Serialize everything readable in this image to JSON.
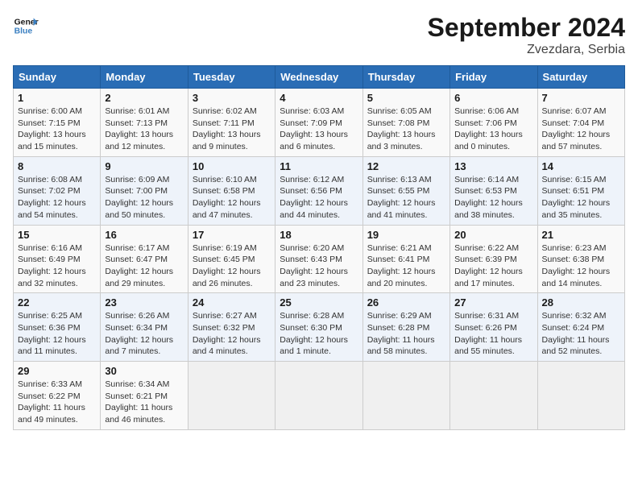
{
  "logo": {
    "line1": "General",
    "line2": "Blue"
  },
  "title": "September 2024",
  "subtitle": "Zvezdara, Serbia",
  "days_of_week": [
    "Sunday",
    "Monday",
    "Tuesday",
    "Wednesday",
    "Thursday",
    "Friday",
    "Saturday"
  ],
  "weeks": [
    [
      {
        "day": "1",
        "info": "Sunrise: 6:00 AM\nSunset: 7:15 PM\nDaylight: 13 hours\nand 15 minutes."
      },
      {
        "day": "2",
        "info": "Sunrise: 6:01 AM\nSunset: 7:13 PM\nDaylight: 13 hours\nand 12 minutes."
      },
      {
        "day": "3",
        "info": "Sunrise: 6:02 AM\nSunset: 7:11 PM\nDaylight: 13 hours\nand 9 minutes."
      },
      {
        "day": "4",
        "info": "Sunrise: 6:03 AM\nSunset: 7:09 PM\nDaylight: 13 hours\nand 6 minutes."
      },
      {
        "day": "5",
        "info": "Sunrise: 6:05 AM\nSunset: 7:08 PM\nDaylight: 13 hours\nand 3 minutes."
      },
      {
        "day": "6",
        "info": "Sunrise: 6:06 AM\nSunset: 7:06 PM\nDaylight: 13 hours\nand 0 minutes."
      },
      {
        "day": "7",
        "info": "Sunrise: 6:07 AM\nSunset: 7:04 PM\nDaylight: 12 hours\nand 57 minutes."
      }
    ],
    [
      {
        "day": "8",
        "info": "Sunrise: 6:08 AM\nSunset: 7:02 PM\nDaylight: 12 hours\nand 54 minutes."
      },
      {
        "day": "9",
        "info": "Sunrise: 6:09 AM\nSunset: 7:00 PM\nDaylight: 12 hours\nand 50 minutes."
      },
      {
        "day": "10",
        "info": "Sunrise: 6:10 AM\nSunset: 6:58 PM\nDaylight: 12 hours\nand 47 minutes."
      },
      {
        "day": "11",
        "info": "Sunrise: 6:12 AM\nSunset: 6:56 PM\nDaylight: 12 hours\nand 44 minutes."
      },
      {
        "day": "12",
        "info": "Sunrise: 6:13 AM\nSunset: 6:55 PM\nDaylight: 12 hours\nand 41 minutes."
      },
      {
        "day": "13",
        "info": "Sunrise: 6:14 AM\nSunset: 6:53 PM\nDaylight: 12 hours\nand 38 minutes."
      },
      {
        "day": "14",
        "info": "Sunrise: 6:15 AM\nSunset: 6:51 PM\nDaylight: 12 hours\nand 35 minutes."
      }
    ],
    [
      {
        "day": "15",
        "info": "Sunrise: 6:16 AM\nSunset: 6:49 PM\nDaylight: 12 hours\nand 32 minutes."
      },
      {
        "day": "16",
        "info": "Sunrise: 6:17 AM\nSunset: 6:47 PM\nDaylight: 12 hours\nand 29 minutes."
      },
      {
        "day": "17",
        "info": "Sunrise: 6:19 AM\nSunset: 6:45 PM\nDaylight: 12 hours\nand 26 minutes."
      },
      {
        "day": "18",
        "info": "Sunrise: 6:20 AM\nSunset: 6:43 PM\nDaylight: 12 hours\nand 23 minutes."
      },
      {
        "day": "19",
        "info": "Sunrise: 6:21 AM\nSunset: 6:41 PM\nDaylight: 12 hours\nand 20 minutes."
      },
      {
        "day": "20",
        "info": "Sunrise: 6:22 AM\nSunset: 6:39 PM\nDaylight: 12 hours\nand 17 minutes."
      },
      {
        "day": "21",
        "info": "Sunrise: 6:23 AM\nSunset: 6:38 PM\nDaylight: 12 hours\nand 14 minutes."
      }
    ],
    [
      {
        "day": "22",
        "info": "Sunrise: 6:25 AM\nSunset: 6:36 PM\nDaylight: 12 hours\nand 11 minutes."
      },
      {
        "day": "23",
        "info": "Sunrise: 6:26 AM\nSunset: 6:34 PM\nDaylight: 12 hours\nand 7 minutes."
      },
      {
        "day": "24",
        "info": "Sunrise: 6:27 AM\nSunset: 6:32 PM\nDaylight: 12 hours\nand 4 minutes."
      },
      {
        "day": "25",
        "info": "Sunrise: 6:28 AM\nSunset: 6:30 PM\nDaylight: 12 hours\nand 1 minute."
      },
      {
        "day": "26",
        "info": "Sunrise: 6:29 AM\nSunset: 6:28 PM\nDaylight: 11 hours\nand 58 minutes."
      },
      {
        "day": "27",
        "info": "Sunrise: 6:31 AM\nSunset: 6:26 PM\nDaylight: 11 hours\nand 55 minutes."
      },
      {
        "day": "28",
        "info": "Sunrise: 6:32 AM\nSunset: 6:24 PM\nDaylight: 11 hours\nand 52 minutes."
      }
    ],
    [
      {
        "day": "29",
        "info": "Sunrise: 6:33 AM\nSunset: 6:22 PM\nDaylight: 11 hours\nand 49 minutes."
      },
      {
        "day": "30",
        "info": "Sunrise: 6:34 AM\nSunset: 6:21 PM\nDaylight: 11 hours\nand 46 minutes."
      },
      {
        "day": "",
        "info": ""
      },
      {
        "day": "",
        "info": ""
      },
      {
        "day": "",
        "info": ""
      },
      {
        "day": "",
        "info": ""
      },
      {
        "day": "",
        "info": ""
      }
    ]
  ]
}
